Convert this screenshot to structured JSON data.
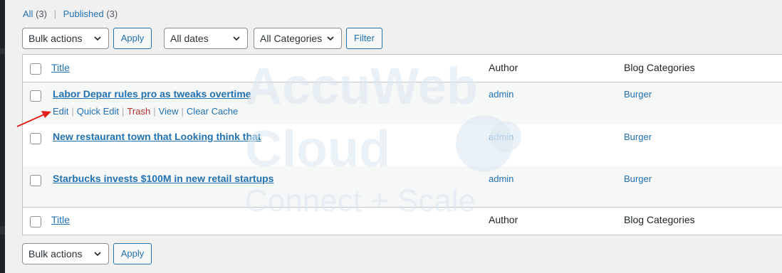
{
  "views": {
    "all_label": "All",
    "all_count": "(3)",
    "published_label": "Published",
    "published_count": "(3)",
    "separator": "|"
  },
  "toolbar_top": {
    "bulk_actions": "Bulk actions",
    "apply": "Apply",
    "dates": "All dates",
    "categories": "All Categories",
    "filter": "Filter"
  },
  "table": {
    "columns": {
      "title": "Title",
      "author": "Author",
      "categories": "Blog Categories"
    },
    "rows": [
      {
        "title": "Labor Depar rules pro as tweaks overtime",
        "author": "admin",
        "category": "Burger"
      },
      {
        "title": "New restaurant town that Looking think that",
        "author": "admin",
        "category": "Burger"
      },
      {
        "title": "Starbucks invests $100M in new retail startups",
        "author": "admin",
        "category": "Burger"
      }
    ],
    "row_actions": {
      "edit": "Edit",
      "quick_edit": "Quick Edit",
      "trash": "Trash",
      "view": "View",
      "clear_cache": "Clear Cache",
      "separator": "|"
    }
  },
  "toolbar_bottom": {
    "bulk_actions": "Bulk actions",
    "apply": "Apply"
  },
  "watermark": {
    "line1": "AccuWeb",
    "line2": "Cloud",
    "line3": "Connect + Scale"
  },
  "colors": {
    "link": "#2271b1",
    "trash": "#b32d2e",
    "background": "#f0f0f1",
    "arrow": "#e0201b",
    "watermark": "#dbe8f0"
  }
}
